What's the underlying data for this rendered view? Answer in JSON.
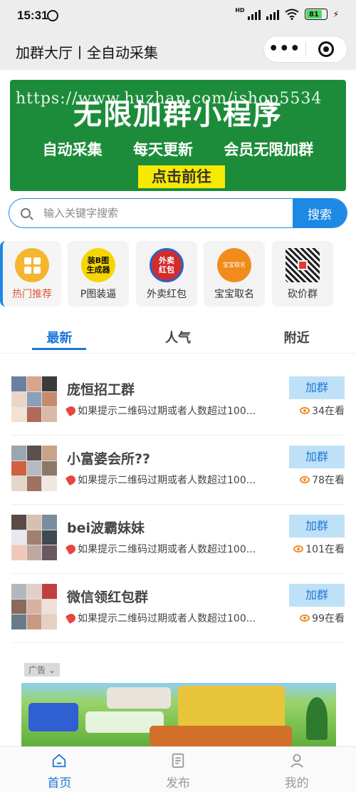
{
  "status_bar": {
    "time": "15:31",
    "network": "HD",
    "battery": "81"
  },
  "nav": {
    "title": "加群大厅丨全自动采集",
    "more_icon": "more-dots-icon",
    "close_icon": "target-icon"
  },
  "banner": {
    "title": "无限加群小程序",
    "watermark": "https://www.huzhan.com/ishop5534",
    "subtitles": [
      "自动采集",
      "每天更新",
      "会员无限加群"
    ],
    "cta": "点击前往"
  },
  "search": {
    "placeholder": "输入关键字搜索",
    "button": "搜索"
  },
  "categories": [
    {
      "label": "热门推荐",
      "icon": "grid-icon",
      "icon_text": ""
    },
    {
      "label": "P图装逼",
      "icon": "photo-generator-icon",
      "icon_text": "装B图生成器"
    },
    {
      "label": "外卖红包",
      "icon": "takeout-redpacket-icon",
      "icon_text": "外卖红包"
    },
    {
      "label": "宝宝取名",
      "icon": "baby-naming-icon",
      "icon_text": "宝宝取名"
    },
    {
      "label": "砍价群",
      "icon": "qr-code-icon",
      "icon_text": ""
    }
  ],
  "tabs": [
    "最新",
    "人气",
    "附近"
  ],
  "groups": [
    {
      "name": "庞恒招工群",
      "desc": "如果提示二维码过期或者人数超过100...",
      "join": "加群",
      "views": "34在看"
    },
    {
      "name": "小富婆会所??",
      "desc": "如果提示二维码过期或者人数超过100...",
      "join": "加群",
      "views": "78在看"
    },
    {
      "name": "bei波霸妹妹",
      "desc": "如果提示二维码过期或者人数超过100...",
      "join": "加群",
      "views": "101在看"
    },
    {
      "name": "微信领红包群",
      "desc": "如果提示二维码过期或者人数超过100...",
      "join": "加群",
      "views": "99在看"
    }
  ],
  "ad": {
    "label": "广告"
  },
  "bottom_nav": [
    {
      "label": "首页",
      "icon": "home-icon"
    },
    {
      "label": "发布",
      "icon": "publish-icon"
    },
    {
      "label": "我的",
      "icon": "profile-icon"
    }
  ],
  "colors": {
    "accent": "#1e78d8",
    "banner": "#1d8c3a",
    "cta": "#f7ea00",
    "join_btn": "#bfe1f7",
    "hot": "#e0573c"
  }
}
